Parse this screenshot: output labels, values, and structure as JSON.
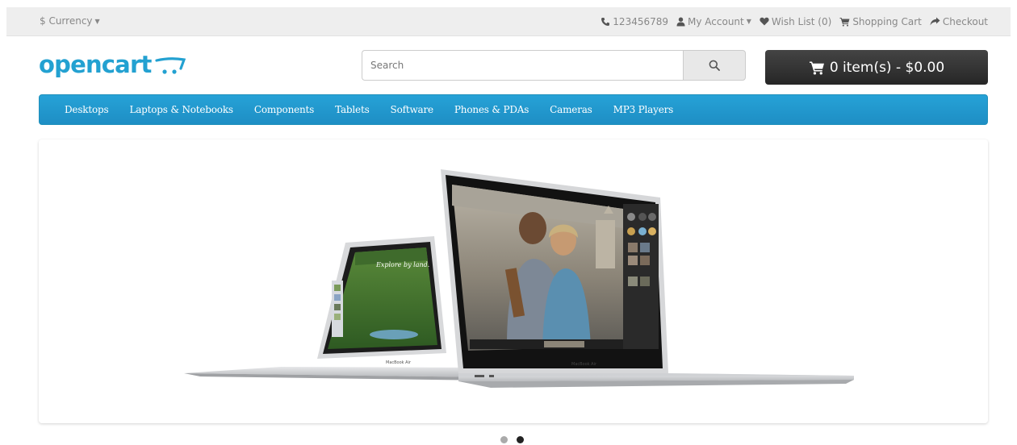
{
  "topbar": {
    "currency_label": "$ Currency",
    "phone": "123456789",
    "my_account": "My Account",
    "wish_list": "Wish List (0)",
    "shopping_cart": "Shopping Cart",
    "checkout": "Checkout"
  },
  "header": {
    "logo_text": "opencart",
    "search_placeholder": "Search",
    "cart_label": "0 item(s) - $0.00"
  },
  "menu": {
    "items": [
      "Desktops",
      "Laptops & Notebooks",
      "Components",
      "Tablets",
      "Software",
      "Phones & PDAs",
      "Cameras",
      "MP3 Players"
    ]
  },
  "slideshow": {
    "slide_count": 2,
    "active_slide": 2,
    "screen_caption": "Explore by land.",
    "laptop_label": "MacBook Air"
  },
  "colors": {
    "brand_blue": "#23a1d1",
    "menu_blue": "#229ac8",
    "cart_dark": "#303030"
  },
  "icons": {
    "phone": "phone-icon",
    "account": "user-icon",
    "wish": "heart-icon",
    "cart": "cart-icon",
    "checkout": "share-arrow-icon",
    "search": "magnifier-icon"
  }
}
